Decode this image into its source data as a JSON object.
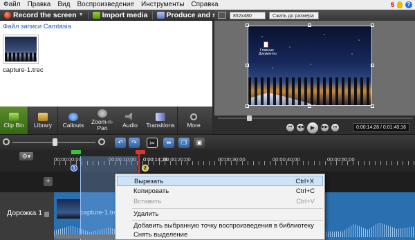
{
  "menu": {
    "items": [
      "Файл",
      "Правка",
      "Вид",
      "Воспроизведение",
      "Инструменты",
      "Справка"
    ],
    "notification_count": "5"
  },
  "toolbar": {
    "record_label": "Record the screen",
    "import_label": "Import media",
    "produce_label": "Produce and share"
  },
  "clip_bin": {
    "header": "Файл записи Camtasia",
    "file_name": "capture-1.trec"
  },
  "preview": {
    "dimensions": "852x480",
    "zoom": "Сжать до размера",
    "desktop_icon_label": "Главные Документы",
    "time": "0:00:14;28 / 0:01:40;16",
    "playhead_fraction": 0.16
  },
  "tools": [
    {
      "label": "Clip Bin",
      "icon": "clip-bin-icon"
    },
    {
      "label": "Library",
      "icon": "library-icon"
    },
    {
      "label": "Callouts",
      "icon": "callouts-icon"
    },
    {
      "label": "Zoom-n-Pan",
      "icon": "zoom-n-pan-icon"
    },
    {
      "label": "Audio",
      "icon": "audio-icon"
    },
    {
      "label": "Transitions",
      "icon": "transitions-icon"
    },
    {
      "label": "More",
      "icon": "more-icon"
    }
  ],
  "timeline": {
    "ticks": [
      "00:00:00;00",
      "00:00:10;00",
      "00:00:20;00",
      "00:00:30;00",
      "00:00:40;00",
      "00:00:50;00"
    ],
    "playhead_time": "0:00:14;28",
    "marker1": "1",
    "marker2": "2",
    "track_name": "Дорожка 1",
    "clip_label": "capture-1.trec"
  },
  "context_menu": {
    "cut": "Вырезать",
    "cut_key": "Ctrl+X",
    "copy": "Копировать",
    "copy_key": "Ctrl+C",
    "paste": "Вставить",
    "paste_key": "Ctrl+V",
    "delete": "Удалить",
    "add_to_library": "Добавить выбранную точку воспроизведения в библиотеку",
    "deselect": "Снять выделение"
  }
}
